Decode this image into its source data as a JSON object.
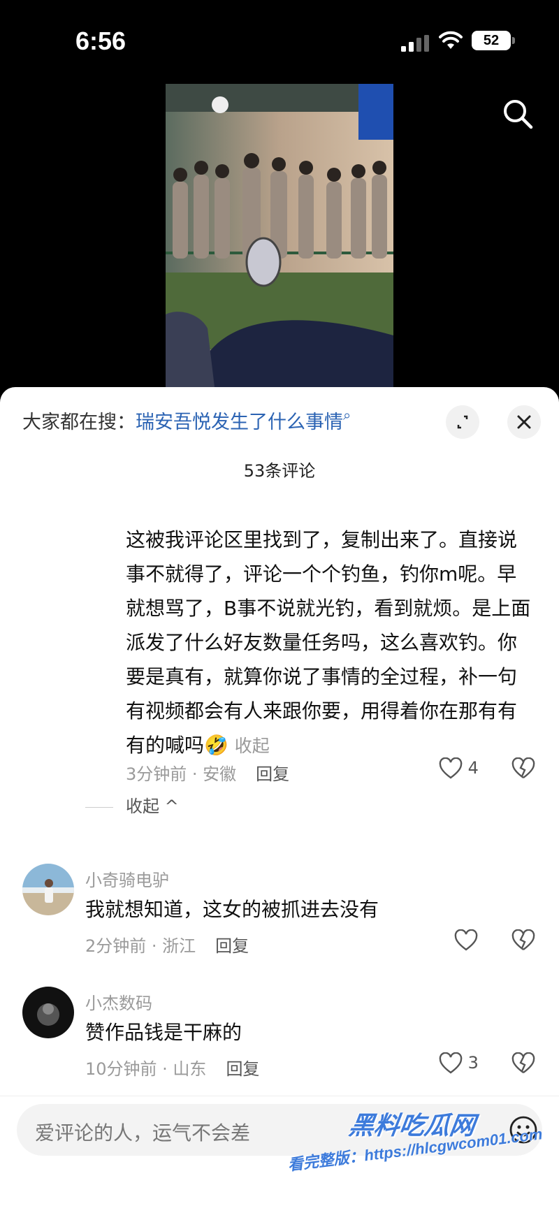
{
  "status": {
    "time": "6:56",
    "battery": "52"
  },
  "sheet": {
    "search_prefix": "大家都在搜：",
    "search_query": "瑞安吾悦发生了什么事情",
    "comment_count": "53条评论",
    "expanded_reply": {
      "text": "这被我评论区里找到了，复制出来了。直接说事不就得了，评论一个个钓鱼，钓你m呢。早就想骂了，B事不说就光钓，看到就烦。是上面派发了什么好友数量任务吗，这么喜欢钓。你要是真有，就算你说了事情的全过程，补一句有视频都会有人来跟你要，用得着你在那有有有的喊吗",
      "emoji": "🤣",
      "collapse_inline": "收起",
      "meta": "3分钟前 · 安徽",
      "reply": "回复",
      "likes": "4"
    },
    "fold_label": "收起 ^",
    "comments": [
      {
        "user": "小奇骑电驴",
        "text": "我就想知道，这女的被抓进去没有",
        "meta": "2分钟前 · 浙江",
        "reply": "回复",
        "likes": ""
      },
      {
        "user": "小杰数码",
        "text": "赞作品钱是干麻的",
        "meta": "10分钟前 · 山东",
        "reply": "回复",
        "likes": "3"
      }
    ],
    "input_placeholder": "爱评论的人，运气不会差"
  },
  "watermark": {
    "brand": "黑料吃瓜网",
    "url": "看完整版：https://hlcgwcom01.com"
  },
  "colors": {
    "link": "#2b63b3",
    "muted": "#9a9a9a",
    "watermark": "#3d7bdb"
  },
  "icons": [
    "search-icon",
    "expand-icon",
    "close-icon",
    "heart-icon",
    "broken-heart-icon",
    "emoji-icon",
    "signal-icon",
    "wifi-icon",
    "battery-icon"
  ]
}
